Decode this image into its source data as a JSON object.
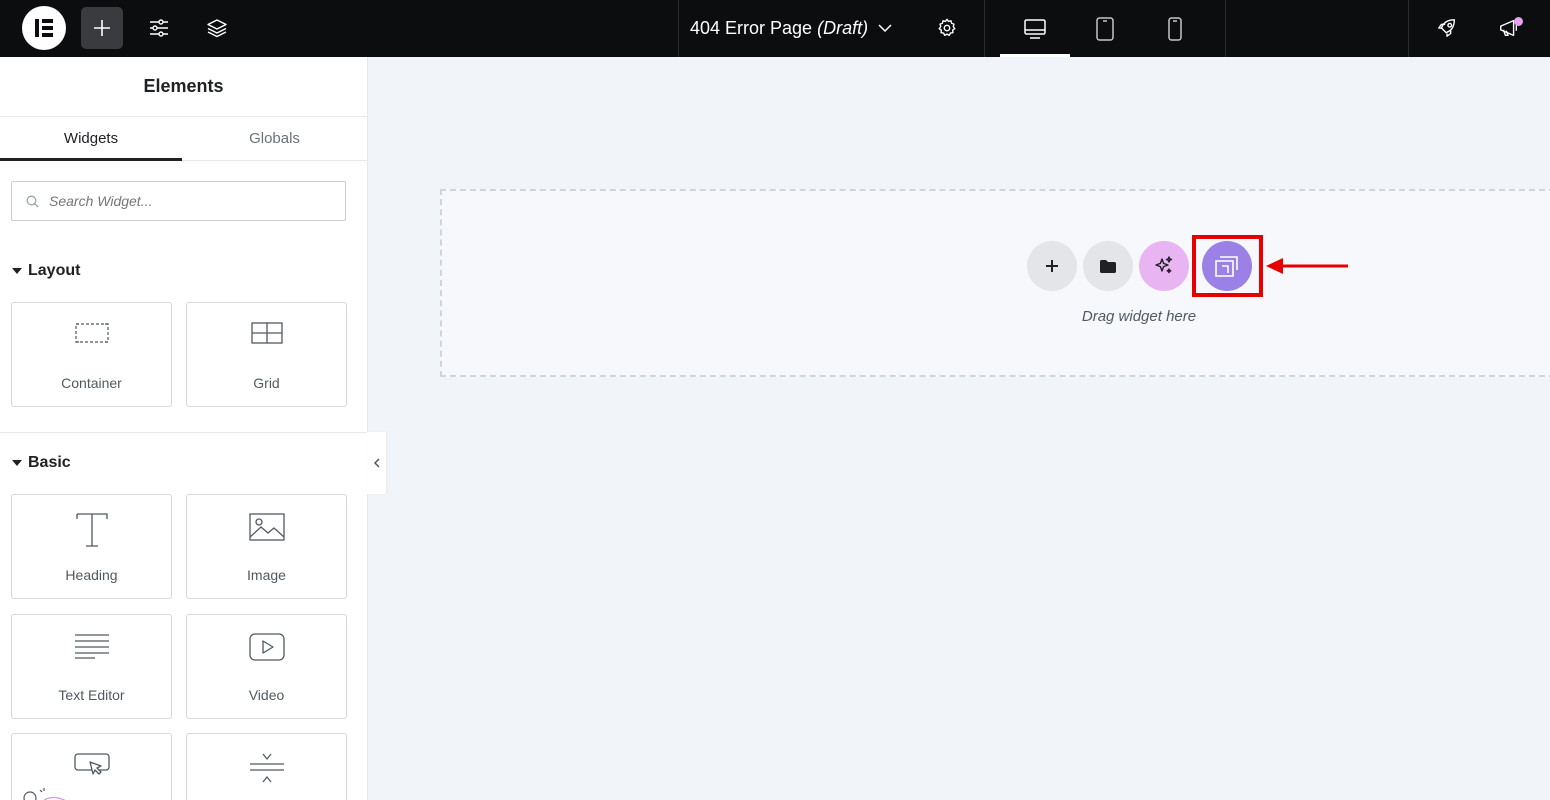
{
  "topbar": {
    "document_name": "404 Error Page",
    "document_status": "(Draft)",
    "icons": [
      "elementor-logo-icon",
      "add-element-icon",
      "site-settings-icon",
      "structure-layers-icon",
      "chevron-down-icon",
      "page-settings-icon",
      "desktop-icon",
      "tablet-icon",
      "mobile-icon",
      "publish-rocket-icon",
      "notifications-megaphone-icon"
    ],
    "active_device": "desktop"
  },
  "panel": {
    "title": "Elements",
    "tabs": [
      {
        "label": "Widgets",
        "active": true
      },
      {
        "label": "Globals",
        "active": false
      }
    ],
    "search": {
      "placeholder": "Search Widget...",
      "value": ""
    },
    "sections": [
      {
        "label": "Layout",
        "widgets": [
          {
            "label": "Container",
            "icon": "container-icon"
          },
          {
            "label": "Grid",
            "icon": "grid-icon"
          }
        ]
      },
      {
        "label": "Basic",
        "widgets": [
          {
            "label": "Heading",
            "icon": "heading-icon"
          },
          {
            "label": "Image",
            "icon": "image-icon"
          },
          {
            "label": "Text Editor",
            "icon": "text-editor-icon"
          },
          {
            "label": "Video",
            "icon": "video-icon"
          },
          {
            "label": "",
            "icon": "button-icon"
          },
          {
            "label": "",
            "icon": "divider-icon"
          }
        ]
      }
    ]
  },
  "canvas": {
    "drag_text": "Drag widget here",
    "buttons": [
      "add-section-icon",
      "template-library-folder-icon",
      "ai-sparkle-icon",
      "website-templates-icon"
    ]
  },
  "colors": {
    "topbar_bg": "#0c0d0e",
    "canvas_bg": "#f1f4f9",
    "ai_button": "#e8b4f2",
    "templates_button": "#9b80e6",
    "highlight": "#e60000"
  }
}
